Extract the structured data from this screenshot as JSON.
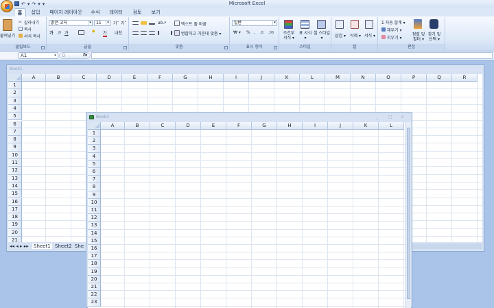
{
  "app": {
    "title": "Microsoft Excel"
  },
  "qat": {
    "save_icon": "save-icon",
    "undo_glyph": "↶",
    "redo_glyph": "↷",
    "more_glyph": "▾"
  },
  "tabs": [
    "홈",
    "삽입",
    "페이지 레이아웃",
    "수식",
    "데이터",
    "검토",
    "보기"
  ],
  "ribbon": {
    "clipboard": {
      "label": "클립보드",
      "paste": "붙여넣기",
      "cut": "잘라내기",
      "copy": "복사",
      "format_painter": "서식 복사"
    },
    "font": {
      "label": "글꼴",
      "font_name": "맑은 고딕",
      "font_size": "11",
      "bold": "가",
      "italic": "가",
      "underline": "가",
      "grow": "가ˆ",
      "shrink": "가ˇ",
      "korean": "내천",
      "fill_glyph": "◆",
      "color_glyph": "가"
    },
    "alignment": {
      "label": "맞춤",
      "wrap_text": "텍스트 줄 바꿈",
      "merge_center": "병합하고 가운데 맞춤 ▾"
    },
    "number": {
      "label": "표시 형식",
      "format": "일반",
      "currency": "₩ ▾",
      "percent": "%",
      "comma": ","
    },
    "styles": {
      "label": "스타일",
      "conditional": "조건부 서식 ▾",
      "table": "표 서식 ▾",
      "cell": "셀 스타일 ▾"
    },
    "cells": {
      "label": "셀",
      "insert": "삽입 ▾",
      "delete": "삭제 ▾",
      "format": "서식 ▾"
    },
    "editing": {
      "label": "편집",
      "autosum": "Σ 자동 합계 ▾",
      "fill": "채우기 ▾",
      "clear": "지우기 ▾",
      "sort": "정렬 및 필터 ▾",
      "find": "찾기 및 선택 ▾"
    }
  },
  "formula_bar": {
    "cell_ref": "A1",
    "fx": "fx",
    "content": ""
  },
  "book1": {
    "title": "Book1",
    "columns": [
      "A",
      "B",
      "C",
      "D",
      "E",
      "F",
      "G",
      "H",
      "I",
      "J",
      "K",
      "L",
      "M",
      "N",
      "O",
      "P",
      "Q",
      "R"
    ],
    "rows": [
      "1",
      "2",
      "3",
      "4",
      "5",
      "6",
      "7",
      "8",
      "9",
      "10",
      "11",
      "12",
      "13",
      "14",
      "15",
      "16",
      "17",
      "18",
      "19",
      "20",
      "21"
    ],
    "sheets": [
      "Sheet1",
      "Sheet2",
      "She"
    ]
  },
  "book3": {
    "title": "Book3",
    "columns": [
      "A",
      "B",
      "C",
      "D",
      "E",
      "F",
      "G",
      "H",
      "I",
      "J",
      "K",
      "L"
    ],
    "rows": [
      "1",
      "2",
      "3",
      "4",
      "5",
      "6",
      "7",
      "8",
      "9",
      "10",
      "11",
      "12",
      "13",
      "14",
      "15",
      "16",
      "17",
      "18",
      "19",
      "20",
      "21",
      "22",
      "23"
    ],
    "controls": [
      "_",
      "□",
      "×"
    ]
  }
}
